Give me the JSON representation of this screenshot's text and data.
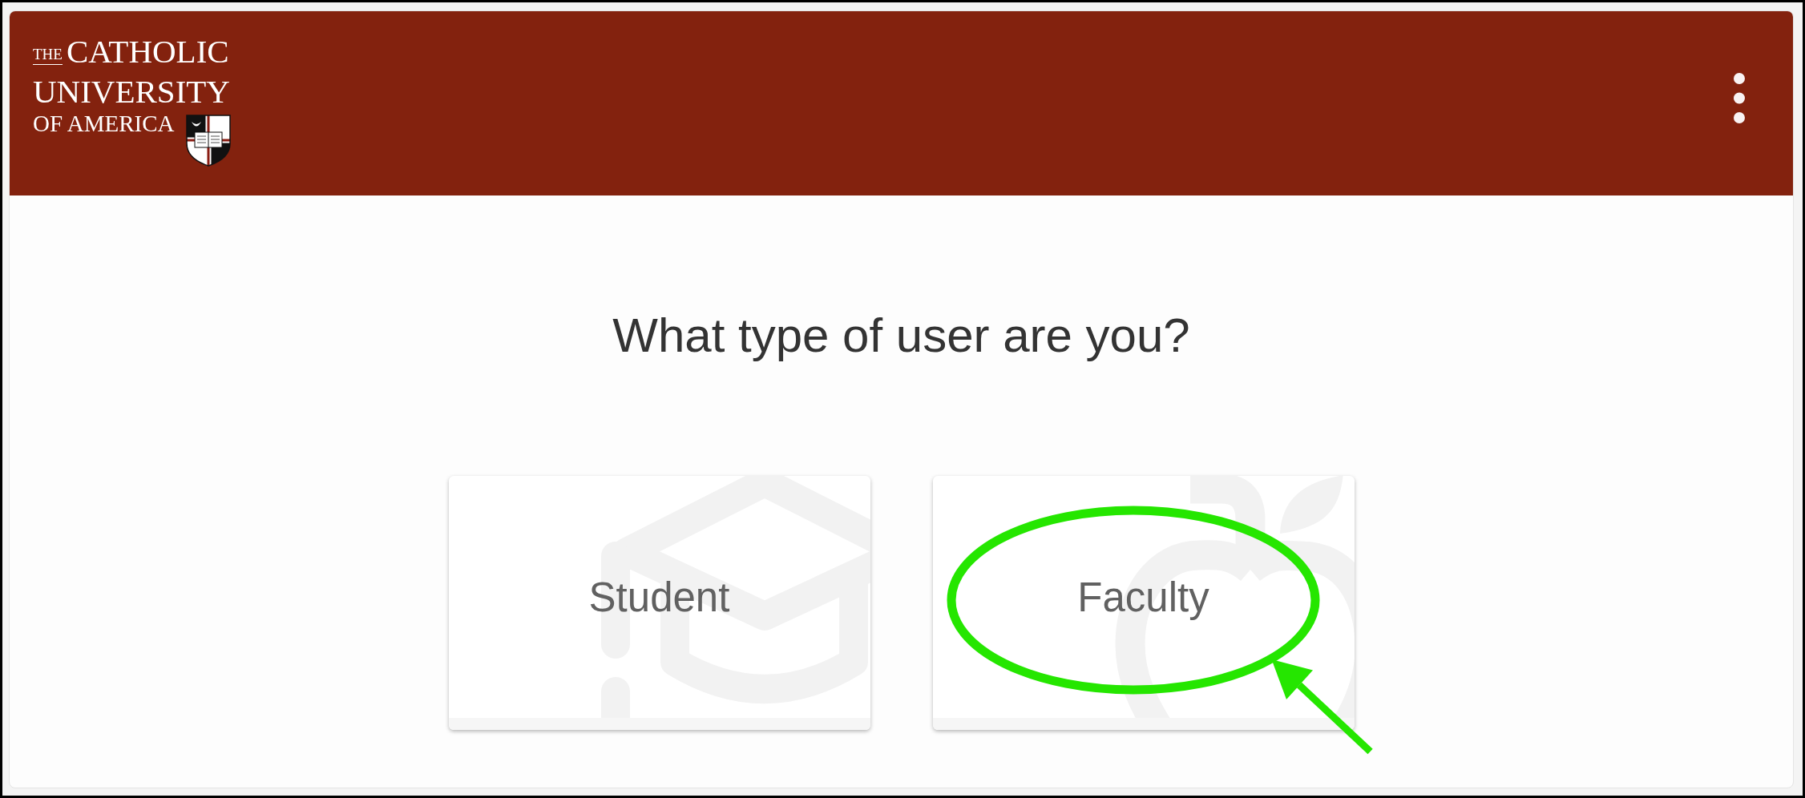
{
  "header": {
    "logo": {
      "prefix": "THE",
      "lines": [
        "CATHOLIC",
        "UNIVERSITY",
        "OF AMERICA"
      ]
    }
  },
  "prompt": "What type of user are you?",
  "options": [
    {
      "label": "Student",
      "kind": "student",
      "highlighted": false
    },
    {
      "label": "Faculty",
      "kind": "faculty",
      "highlighted": true
    }
  ]
}
